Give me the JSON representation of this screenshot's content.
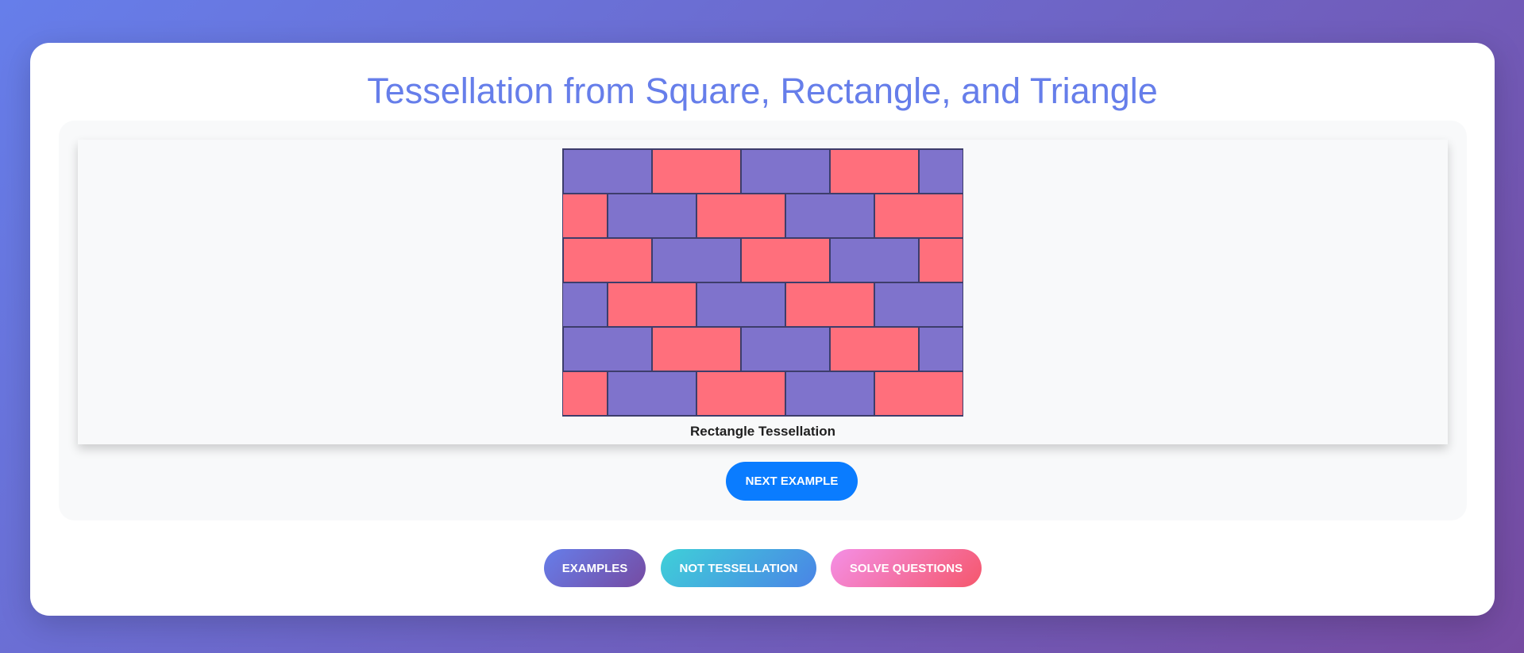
{
  "page": {
    "title": "Tessellation from Square, Rectangle, and Triangle"
  },
  "example": {
    "caption": "Rectangle Tessellation",
    "pattern": "running-bond brick",
    "colors": {
      "primary": "#7f73cc",
      "secondary": "#ff6f7c",
      "outline": "#3d3d6b"
    }
  },
  "buttons": {
    "next": "NEXT EXAMPLE",
    "examples": "EXAMPLES",
    "not_tessellation": "NOT TESSELLATION",
    "solve_questions": "SOLVE QUESTIONS"
  },
  "theme": {
    "background_start": "#667eea",
    "background_end": "#764ba2",
    "title_color": "#667eea",
    "next_button_color": "#0a7cff"
  }
}
